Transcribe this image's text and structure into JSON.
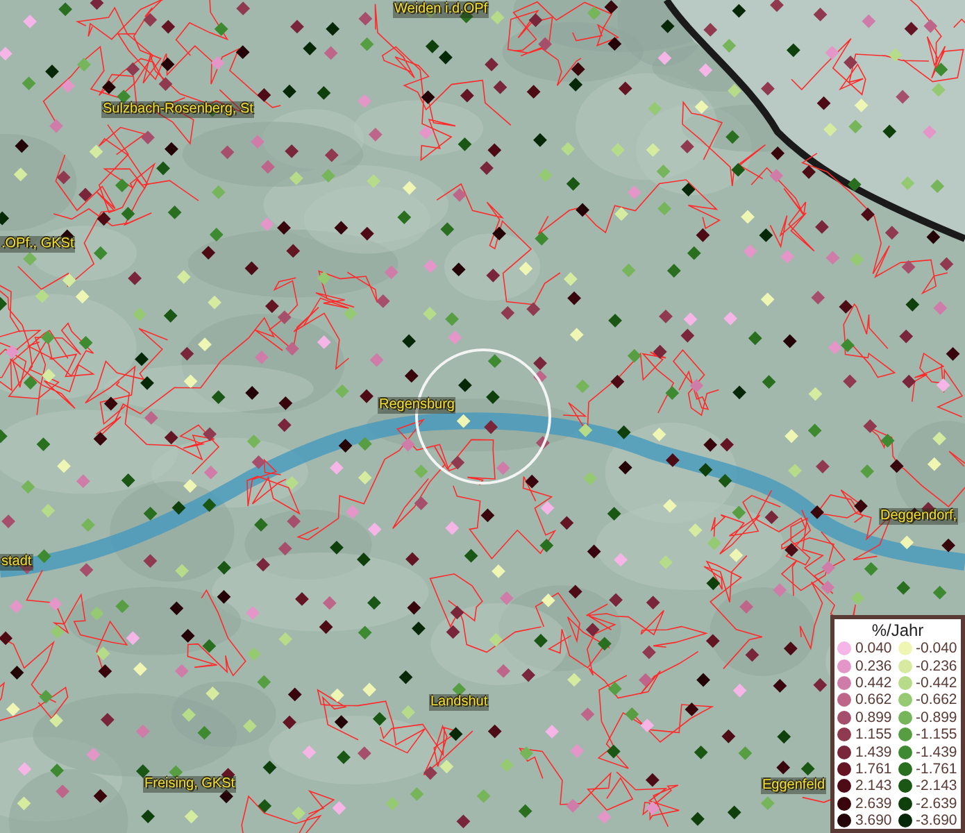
{
  "map": {
    "place_labels": [
      {
        "text": "Weiden i.d.OPf"
      },
      {
        "text": "Sulzbach-Rosenberg, St"
      },
      {
        "text": ".OPf., GKSt"
      },
      {
        "text": "Regensburg"
      },
      {
        "text": "Deggendorf,"
      },
      {
        "text": "stadt"
      },
      {
        "text": "Landshut"
      },
      {
        "text": "Freising, GKSt"
      },
      {
        "text": "Eggenfeld"
      }
    ]
  },
  "legend": {
    "title": "%/Jahr",
    "rows": [
      {
        "positive": {
          "value": "0.040",
          "color": "#f5b5e6"
        },
        "negative": {
          "value": "-0.040",
          "color": "#eff6b4"
        }
      },
      {
        "positive": {
          "value": "0.236",
          "color": "#e596c8"
        },
        "negative": {
          "value": "-0.236",
          "color": "#d5eca0"
        }
      },
      {
        "positive": {
          "value": "0.442",
          "color": "#d07ca8"
        },
        "negative": {
          "value": "-0.442",
          "color": "#b6dc8a"
        }
      },
      {
        "positive": {
          "value": "0.662",
          "color": "#bd6689"
        },
        "negative": {
          "value": "-0.662",
          "color": "#95ca72"
        }
      },
      {
        "positive": {
          "value": "0.899",
          "color": "#a64f6c"
        },
        "negative": {
          "value": "-0.899",
          "color": "#76b55a"
        }
      },
      {
        "positive": {
          "value": "1.155",
          "color": "#903a50"
        },
        "negative": {
          "value": "-1.155",
          "color": "#579e43"
        }
      },
      {
        "positive": {
          "value": "1.439",
          "color": "#79263a"
        },
        "negative": {
          "value": "-1.439",
          "color": "#3d8a30"
        }
      },
      {
        "positive": {
          "value": "1.761",
          "color": "#641524"
        },
        "negative": {
          "value": "-1.761",
          "color": "#2a6f20"
        }
      },
      {
        "positive": {
          "value": "2.143",
          "color": "#4d0b15"
        },
        "negative": {
          "value": "-2.143",
          "color": "#1a5714"
        }
      },
      {
        "positive": {
          "value": "2.639",
          "color": "#39050c"
        },
        "negative": {
          "value": "-2.639",
          "color": "#0f400c"
        }
      },
      {
        "positive": {
          "value": "3.690",
          "color": "#240306"
        },
        "negative": {
          "value": "-3.690",
          "color": "#072806"
        }
      }
    ]
  }
}
